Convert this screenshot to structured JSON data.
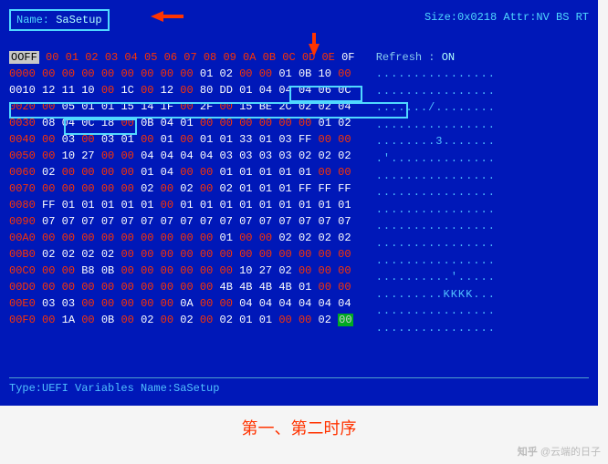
{
  "header": {
    "name_label": "Name: ",
    "name_value": "SaSetup",
    "size_attr": "Size:0x0218 Attr:NV BS RT"
  },
  "sidebar": {
    "refresh_label": "Refresh   : ",
    "refresh_value": "ON",
    "dots": [
      "................",
      "................",
      "......./........",
      "................",
      "........3.......",
      ".'..............",
      "................",
      "................",
      "................",
      "................",
      "................",
      "................",
      "..........'.....",
      ".........KKKK...",
      "................",
      "................"
    ]
  },
  "offset_header": {
    "ofmark": "OOFF",
    "cols": "00 01 02 03 04 05 06 07 08 09 0A 0B 0C 0D 0E",
    "last": "0F"
  },
  "rows": [
    {
      "ofs": "0000",
      "sel": false,
      "bytes": [
        {
          "t": "00",
          "c": "r"
        },
        {
          "t": "00",
          "c": "r"
        },
        {
          "t": "00",
          "c": "r"
        },
        {
          "t": "00",
          "c": "r"
        },
        {
          "t": "00",
          "c": "r"
        },
        {
          "t": "00",
          "c": "r"
        },
        {
          "t": "00",
          "c": "r"
        },
        {
          "t": "00",
          "c": "r"
        },
        {
          "t": "01",
          "c": "w"
        },
        {
          "t": "02",
          "c": "w"
        },
        {
          "t": "00",
          "c": "r"
        },
        {
          "t": "00",
          "c": "r"
        },
        {
          "t": "01",
          "c": "w"
        },
        {
          "t": "0B",
          "c": "w"
        },
        {
          "t": "10",
          "c": "w"
        },
        {
          "t": "00",
          "c": "r"
        }
      ]
    },
    {
      "ofs": "0010",
      "sel": true,
      "bytes": [
        {
          "t": "12",
          "c": "w"
        },
        {
          "t": "11",
          "c": "w"
        },
        {
          "t": "10",
          "c": "w"
        },
        {
          "t": "00",
          "c": "r"
        },
        {
          "t": "1C",
          "c": "w"
        },
        {
          "t": "00",
          "c": "r"
        },
        {
          "t": "12",
          "c": "w"
        },
        {
          "t": "00",
          "c": "r"
        },
        {
          "t": "80",
          "c": "w"
        },
        {
          "t": "DD",
          "c": "w"
        },
        {
          "t": "01",
          "c": "w"
        },
        {
          "t": "04",
          "c": "w"
        },
        {
          "t": "04",
          "c": "w"
        },
        {
          "t": "04",
          "c": "w"
        },
        {
          "t": "06",
          "c": "w"
        },
        {
          "t": "0C",
          "c": "w"
        }
      ]
    },
    {
      "ofs": "0020",
      "sel": false,
      "bytes": [
        {
          "t": "00",
          "c": "r"
        },
        {
          "t": "05",
          "c": "w"
        },
        {
          "t": "01",
          "c": "w"
        },
        {
          "t": "01",
          "c": "w"
        },
        {
          "t": "15",
          "c": "w"
        },
        {
          "t": "14",
          "c": "w"
        },
        {
          "t": "1F",
          "c": "w"
        },
        {
          "t": "00",
          "c": "r"
        },
        {
          "t": "2F",
          "c": "w"
        },
        {
          "t": "00",
          "c": "r"
        },
        {
          "t": "15",
          "c": "w"
        },
        {
          "t": "BE",
          "c": "w"
        },
        {
          "t": "2C",
          "c": "w"
        },
        {
          "t": "02",
          "c": "w"
        },
        {
          "t": "02",
          "c": "w"
        },
        {
          "t": "04",
          "c": "w"
        }
      ]
    },
    {
      "ofs": "0030",
      "sel": false,
      "bytes": [
        {
          "t": "08",
          "c": "w"
        },
        {
          "t": "04",
          "c": "w"
        },
        {
          "t": "0C",
          "c": "w"
        },
        {
          "t": "18",
          "c": "w"
        },
        {
          "t": "00",
          "c": "r"
        },
        {
          "t": "0B",
          "c": "w"
        },
        {
          "t": "04",
          "c": "w"
        },
        {
          "t": "01",
          "c": "w"
        },
        {
          "t": "00",
          "c": "r"
        },
        {
          "t": "00",
          "c": "r"
        },
        {
          "t": "00",
          "c": "r"
        },
        {
          "t": "00",
          "c": "r"
        },
        {
          "t": "00",
          "c": "r"
        },
        {
          "t": "00",
          "c": "r"
        },
        {
          "t": "01",
          "c": "w"
        },
        {
          "t": "02",
          "c": "w"
        }
      ]
    },
    {
      "ofs": "0040",
      "sel": false,
      "bytes": [
        {
          "t": "00",
          "c": "r"
        },
        {
          "t": "03",
          "c": "w"
        },
        {
          "t": "00",
          "c": "r"
        },
        {
          "t": "03",
          "c": "w"
        },
        {
          "t": "01",
          "c": "w"
        },
        {
          "t": "00",
          "c": "r"
        },
        {
          "t": "01",
          "c": "w"
        },
        {
          "t": "00",
          "c": "r"
        },
        {
          "t": "01",
          "c": "w"
        },
        {
          "t": "01",
          "c": "w"
        },
        {
          "t": "33",
          "c": "w"
        },
        {
          "t": "01",
          "c": "w"
        },
        {
          "t": "03",
          "c": "w"
        },
        {
          "t": "FF",
          "c": "w"
        },
        {
          "t": "00",
          "c": "r"
        },
        {
          "t": "00",
          "c": "r"
        }
      ]
    },
    {
      "ofs": "0050",
      "sel": false,
      "bytes": [
        {
          "t": "00",
          "c": "r"
        },
        {
          "t": "10",
          "c": "w"
        },
        {
          "t": "27",
          "c": "w"
        },
        {
          "t": "00",
          "c": "r"
        },
        {
          "t": "00",
          "c": "r"
        },
        {
          "t": "04",
          "c": "w"
        },
        {
          "t": "04",
          "c": "w"
        },
        {
          "t": "04",
          "c": "w"
        },
        {
          "t": "04",
          "c": "w"
        },
        {
          "t": "03",
          "c": "w"
        },
        {
          "t": "03",
          "c": "w"
        },
        {
          "t": "03",
          "c": "w"
        },
        {
          "t": "03",
          "c": "w"
        },
        {
          "t": "02",
          "c": "w"
        },
        {
          "t": "02",
          "c": "w"
        },
        {
          "t": "02",
          "c": "w"
        }
      ]
    },
    {
      "ofs": "0060",
      "sel": false,
      "bytes": [
        {
          "t": "02",
          "c": "w"
        },
        {
          "t": "00",
          "c": "r"
        },
        {
          "t": "00",
          "c": "r"
        },
        {
          "t": "00",
          "c": "r"
        },
        {
          "t": "00",
          "c": "r"
        },
        {
          "t": "01",
          "c": "w"
        },
        {
          "t": "04",
          "c": "w"
        },
        {
          "t": "00",
          "c": "r"
        },
        {
          "t": "00",
          "c": "r"
        },
        {
          "t": "01",
          "c": "w"
        },
        {
          "t": "01",
          "c": "w"
        },
        {
          "t": "01",
          "c": "w"
        },
        {
          "t": "01",
          "c": "w"
        },
        {
          "t": "01",
          "c": "w"
        },
        {
          "t": "00",
          "c": "r"
        },
        {
          "t": "00",
          "c": "r"
        }
      ]
    },
    {
      "ofs": "0070",
      "sel": false,
      "bytes": [
        {
          "t": "00",
          "c": "r"
        },
        {
          "t": "00",
          "c": "r"
        },
        {
          "t": "00",
          "c": "r"
        },
        {
          "t": "00",
          "c": "r"
        },
        {
          "t": "00",
          "c": "r"
        },
        {
          "t": "02",
          "c": "w"
        },
        {
          "t": "00",
          "c": "r"
        },
        {
          "t": "02",
          "c": "w"
        },
        {
          "t": "00",
          "c": "r"
        },
        {
          "t": "02",
          "c": "w"
        },
        {
          "t": "01",
          "c": "w"
        },
        {
          "t": "01",
          "c": "w"
        },
        {
          "t": "01",
          "c": "w"
        },
        {
          "t": "FF",
          "c": "w"
        },
        {
          "t": "FF",
          "c": "w"
        },
        {
          "t": "FF",
          "c": "w"
        }
      ]
    },
    {
      "ofs": "0080",
      "sel": false,
      "bytes": [
        {
          "t": "FF",
          "c": "w"
        },
        {
          "t": "01",
          "c": "w"
        },
        {
          "t": "01",
          "c": "w"
        },
        {
          "t": "01",
          "c": "w"
        },
        {
          "t": "01",
          "c": "w"
        },
        {
          "t": "01",
          "c": "w"
        },
        {
          "t": "00",
          "c": "r"
        },
        {
          "t": "01",
          "c": "w"
        },
        {
          "t": "01",
          "c": "w"
        },
        {
          "t": "01",
          "c": "w"
        },
        {
          "t": "01",
          "c": "w"
        },
        {
          "t": "01",
          "c": "w"
        },
        {
          "t": "01",
          "c": "w"
        },
        {
          "t": "01",
          "c": "w"
        },
        {
          "t": "01",
          "c": "w"
        },
        {
          "t": "01",
          "c": "w"
        }
      ]
    },
    {
      "ofs": "0090",
      "sel": false,
      "bytes": [
        {
          "t": "07",
          "c": "w"
        },
        {
          "t": "07",
          "c": "w"
        },
        {
          "t": "07",
          "c": "w"
        },
        {
          "t": "07",
          "c": "w"
        },
        {
          "t": "07",
          "c": "w"
        },
        {
          "t": "07",
          "c": "w"
        },
        {
          "t": "07",
          "c": "w"
        },
        {
          "t": "07",
          "c": "w"
        },
        {
          "t": "07",
          "c": "w"
        },
        {
          "t": "07",
          "c": "w"
        },
        {
          "t": "07",
          "c": "w"
        },
        {
          "t": "07",
          "c": "w"
        },
        {
          "t": "07",
          "c": "w"
        },
        {
          "t": "07",
          "c": "w"
        },
        {
          "t": "07",
          "c": "w"
        },
        {
          "t": "07",
          "c": "w"
        }
      ]
    },
    {
      "ofs": "00A0",
      "sel": false,
      "bytes": [
        {
          "t": "00",
          "c": "r"
        },
        {
          "t": "00",
          "c": "r"
        },
        {
          "t": "00",
          "c": "r"
        },
        {
          "t": "00",
          "c": "r"
        },
        {
          "t": "00",
          "c": "r"
        },
        {
          "t": "00",
          "c": "r"
        },
        {
          "t": "00",
          "c": "r"
        },
        {
          "t": "00",
          "c": "r"
        },
        {
          "t": "00",
          "c": "r"
        },
        {
          "t": "01",
          "c": "w"
        },
        {
          "t": "00",
          "c": "r"
        },
        {
          "t": "00",
          "c": "r"
        },
        {
          "t": "02",
          "c": "w"
        },
        {
          "t": "02",
          "c": "w"
        },
        {
          "t": "02",
          "c": "w"
        },
        {
          "t": "02",
          "c": "w"
        }
      ]
    },
    {
      "ofs": "00B0",
      "sel": false,
      "bytes": [
        {
          "t": "02",
          "c": "w"
        },
        {
          "t": "02",
          "c": "w"
        },
        {
          "t": "02",
          "c": "w"
        },
        {
          "t": "02",
          "c": "w"
        },
        {
          "t": "00",
          "c": "r"
        },
        {
          "t": "00",
          "c": "r"
        },
        {
          "t": "00",
          "c": "r"
        },
        {
          "t": "00",
          "c": "r"
        },
        {
          "t": "00",
          "c": "r"
        },
        {
          "t": "00",
          "c": "r"
        },
        {
          "t": "00",
          "c": "r"
        },
        {
          "t": "00",
          "c": "r"
        },
        {
          "t": "00",
          "c": "r"
        },
        {
          "t": "00",
          "c": "r"
        },
        {
          "t": "00",
          "c": "r"
        },
        {
          "t": "00",
          "c": "r"
        }
      ]
    },
    {
      "ofs": "00C0",
      "sel": false,
      "bytes": [
        {
          "t": "00",
          "c": "r"
        },
        {
          "t": "00",
          "c": "r"
        },
        {
          "t": "B8",
          "c": "w"
        },
        {
          "t": "0B",
          "c": "w"
        },
        {
          "t": "00",
          "c": "r"
        },
        {
          "t": "00",
          "c": "r"
        },
        {
          "t": "00",
          "c": "r"
        },
        {
          "t": "00",
          "c": "r"
        },
        {
          "t": "00",
          "c": "r"
        },
        {
          "t": "00",
          "c": "r"
        },
        {
          "t": "10",
          "c": "w"
        },
        {
          "t": "27",
          "c": "w"
        },
        {
          "t": "02",
          "c": "w"
        },
        {
          "t": "00",
          "c": "r"
        },
        {
          "t": "00",
          "c": "r"
        },
        {
          "t": "00",
          "c": "r"
        }
      ]
    },
    {
      "ofs": "00D0",
      "sel": false,
      "bytes": [
        {
          "t": "00",
          "c": "r"
        },
        {
          "t": "00",
          "c": "r"
        },
        {
          "t": "00",
          "c": "r"
        },
        {
          "t": "00",
          "c": "r"
        },
        {
          "t": "00",
          "c": "r"
        },
        {
          "t": "00",
          "c": "r"
        },
        {
          "t": "00",
          "c": "r"
        },
        {
          "t": "00",
          "c": "r"
        },
        {
          "t": "00",
          "c": "r"
        },
        {
          "t": "4B",
          "c": "w"
        },
        {
          "t": "4B",
          "c": "w"
        },
        {
          "t": "4B",
          "c": "w"
        },
        {
          "t": "4B",
          "c": "w"
        },
        {
          "t": "01",
          "c": "w"
        },
        {
          "t": "00",
          "c": "r"
        },
        {
          "t": "00",
          "c": "r"
        }
      ]
    },
    {
      "ofs": "00E0",
      "sel": false,
      "bytes": [
        {
          "t": "03",
          "c": "w"
        },
        {
          "t": "03",
          "c": "w"
        },
        {
          "t": "00",
          "c": "r"
        },
        {
          "t": "00",
          "c": "r"
        },
        {
          "t": "00",
          "c": "r"
        },
        {
          "t": "00",
          "c": "r"
        },
        {
          "t": "00",
          "c": "r"
        },
        {
          "t": "0A",
          "c": "w"
        },
        {
          "t": "00",
          "c": "r"
        },
        {
          "t": "00",
          "c": "r"
        },
        {
          "t": "04",
          "c": "w"
        },
        {
          "t": "04",
          "c": "w"
        },
        {
          "t": "04",
          "c": "w"
        },
        {
          "t": "04",
          "c": "w"
        },
        {
          "t": "04",
          "c": "w"
        },
        {
          "t": "04",
          "c": "w"
        }
      ]
    },
    {
      "ofs": "00F0",
      "sel": false,
      "bytes": [
        {
          "t": "00",
          "c": "r"
        },
        {
          "t": "1A",
          "c": "w"
        },
        {
          "t": "00",
          "c": "r"
        },
        {
          "t": "0B",
          "c": "w"
        },
        {
          "t": "00",
          "c": "r"
        },
        {
          "t": "02",
          "c": "w"
        },
        {
          "t": "00",
          "c": "r"
        },
        {
          "t": "02",
          "c": "w"
        },
        {
          "t": "00",
          "c": "r"
        },
        {
          "t": "02",
          "c": "w"
        },
        {
          "t": "01",
          "c": "w"
        },
        {
          "t": "01",
          "c": "w"
        },
        {
          "t": "00",
          "c": "r"
        },
        {
          "t": "00",
          "c": "r"
        },
        {
          "t": "02",
          "c": "w"
        },
        {
          "t": "00",
          "c": "g"
        }
      ]
    }
  ],
  "footer": {
    "text": "Type:UEFI Variables  Name:SaSetup"
  },
  "caption": "第一、第二时序",
  "watermark": {
    "logo": "知乎",
    "at": " @云端的日子"
  }
}
